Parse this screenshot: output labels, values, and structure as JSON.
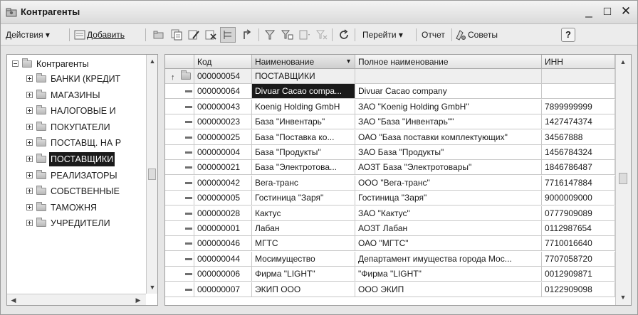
{
  "window": {
    "title": "Контрагенты",
    "controls": {
      "minimize": "_",
      "maximize": "□",
      "close": "✕"
    }
  },
  "toolbar": {
    "actions_label": "Действия ▾",
    "add_label": "Добавить",
    "goto_label": "Перейти ▾",
    "report_label": "Отчет",
    "tips_label": "Советы",
    "help_label": "?"
  },
  "tree": {
    "root": "Контрагенты",
    "items": [
      {
        "label": "БАНКИ (КРЕДИТ"
      },
      {
        "label": "МАГАЗИНЫ"
      },
      {
        "label": "НАЛОГОВЫЕ И"
      },
      {
        "label": "ПОКУПАТЕЛИ"
      },
      {
        "label": "ПОСТАВЩ. НА Р"
      },
      {
        "label": "ПОСТАВЩИКИ",
        "selected": true
      },
      {
        "label": "РЕАЛИЗАТОРЫ"
      },
      {
        "label": "СОБСТВЕННЫЕ"
      },
      {
        "label": "ТАМОЖНЯ"
      },
      {
        "label": "УЧРЕДИТЕЛИ"
      }
    ]
  },
  "grid": {
    "columns": {
      "code": "Код",
      "name": "Наименование",
      "full_name": "Полное наименование",
      "inn": "ИНН"
    },
    "sort_indicator": "▾",
    "rows": [
      {
        "type": "group",
        "code": "000000054",
        "name": "ПОСТАВЩИКИ",
        "full_name": "",
        "inn": ""
      },
      {
        "type": "item",
        "code": "000000064",
        "name": "Divuar Cacao compa...",
        "full_name": "Divuar Cacao company",
        "inn": "",
        "selected": true
      },
      {
        "type": "item",
        "code": "000000043",
        "name": "Koenig Holding GmbH",
        "full_name": "ЗАО \"Koenig Holding GmbH\"",
        "inn": "7899999999"
      },
      {
        "type": "item",
        "code": "000000023",
        "name": "База \"Инвентарь\"",
        "full_name": "ЗАО \"База \"Инвентарь\"\"",
        "inn": "1427474374"
      },
      {
        "type": "item",
        "code": "000000025",
        "name": "База \"Поставка ко...",
        "full_name": "ОАО \"База поставки комплектующих\"",
        "inn": "34567888"
      },
      {
        "type": "item",
        "code": "000000004",
        "name": "База \"Продукты\"",
        "full_name": "ЗАО База \"Продукты\"",
        "inn": "1456784324"
      },
      {
        "type": "item",
        "code": "000000021",
        "name": "База \"Электротова...",
        "full_name": "АОЗТ База \"Электротовары\"",
        "inn": "1846786487"
      },
      {
        "type": "item",
        "code": "000000042",
        "name": "Вега-транс",
        "full_name": "ООО \"Вега-транс\"",
        "inn": "7716147884"
      },
      {
        "type": "item",
        "code": "000000005",
        "name": "Гостиница \"Заря\"",
        "full_name": "Гостиница \"Заря\"",
        "inn": "9000009000"
      },
      {
        "type": "item",
        "code": "000000028",
        "name": "Кактус",
        "full_name": "ЗАО \"Кактус\"",
        "inn": "0777909089"
      },
      {
        "type": "item",
        "code": "000000001",
        "name": "Лабан",
        "full_name": "АОЗТ Лабан",
        "inn": "0112987654"
      },
      {
        "type": "item",
        "code": "000000046",
        "name": "МГТС",
        "full_name": "ОАО \"МГТС\"",
        "inn": "7710016640"
      },
      {
        "type": "item",
        "code": "000000044",
        "name": "Мосимущество",
        "full_name": "Департамент имущества города Мос...",
        "inn": "7707058720"
      },
      {
        "type": "item",
        "code": "000000006",
        "name": "Фирма \"LIGHT\"",
        "full_name": " \"Фирма \"LIGHT\"",
        "inn": "0012909871"
      },
      {
        "type": "item",
        "code": "000000007",
        "name": "ЭКИП ООО",
        "full_name": "ООО ЭКИП",
        "inn": "0122909098"
      }
    ]
  },
  "colors": {
    "selection": "#1a1a1a",
    "window_bg": "#e6e6e6",
    "grid_line": "#c8c8c8"
  }
}
